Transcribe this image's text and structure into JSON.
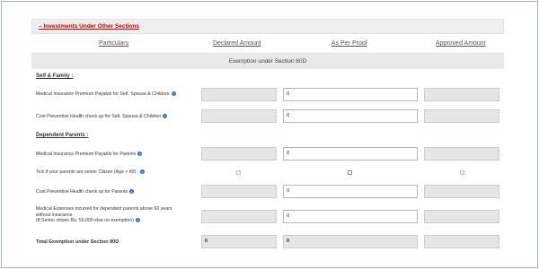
{
  "section": {
    "toggle": "–",
    "title": "Investments Under Other Sections"
  },
  "columns": {
    "particulars": "Particulars",
    "declared": "Declared Amount",
    "proof": "As Per Proof",
    "approved": "Approved Amount"
  },
  "exemption_title": "Exemption under Section 80D",
  "groups": {
    "self": "Self & Family :",
    "parents": "Dependent Parents :"
  },
  "rows": {
    "r1": {
      "label": "Medical Insurance Premium Payable for Self, Spouse & Children",
      "proof": "0"
    },
    "r2": {
      "label": "Cost Preventive Health check up for Self, Spouse & Children",
      "proof": "0"
    },
    "r3": {
      "label": "Medical Insurance Premium Payable for Parents",
      "proof": "0"
    },
    "r4": {
      "label": "Tick if your parents are senior Citizen (Age > 60) :",
      "checked": false
    },
    "r5": {
      "label": "Cost Preventive Health check up for Parents",
      "proof": "0"
    },
    "r6": {
      "line1": "Medical Expenses incurred for dependent parents above 60 years",
      "line2": "without insurance",
      "line3": "(If Senior citizen Rs. 50,000 else no exemption)",
      "proof": "0"
    }
  },
  "total": {
    "label": "Total Exemption under Section 80D",
    "declared": "0",
    "proof": "0"
  },
  "icons": {
    "info": "info-icon",
    "info_glyph": "i"
  },
  "colors": {
    "section_title": "#c00000",
    "info_icon": "#2f6fb8",
    "header_bg": "#eeeeee"
  }
}
